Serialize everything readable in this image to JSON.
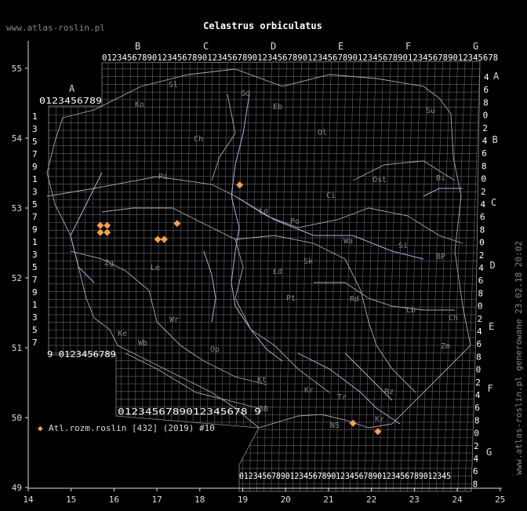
{
  "header": {
    "site": "www.atlas-roslin.pl",
    "title": "Celastrus orbiculatus",
    "generated": "www.atlas-roslin.pl generowane 23.02.18 20:02"
  },
  "axes": {
    "x_ticks": [
      "14",
      "15",
      "16",
      "17",
      "18",
      "19",
      "20",
      "21",
      "22",
      "23",
      "24",
      "25"
    ],
    "y_ticks": [
      "55",
      "54",
      "53",
      "52",
      "51",
      "50",
      "49"
    ]
  },
  "grid_letters": {
    "top_mid": [
      "B",
      "C",
      "D",
      "E",
      "F",
      "G"
    ],
    "top_left": "A",
    "right": [
      "A",
      "B",
      "C",
      "D",
      "E",
      "F",
      "G"
    ]
  },
  "grid_digits": {
    "top_row": "0123456789012345678901234567890123456789012345678901234567890123456789012345678",
    "left_top_row": "0123456789",
    "bottom_left_row": "9 0123456789",
    "bottom_mid_row": "0123456789012345678 9",
    "bottom_right_row": "0123456789012345678901234567890123456789012345",
    "left_col": [
      "1",
      "3",
      "5",
      "7",
      "9",
      "1",
      "3",
      "5",
      "7",
      "9",
      "1",
      "3",
      "5",
      "7",
      "9",
      "1",
      "3",
      "5",
      "7"
    ],
    "right_col": [
      "4",
      "6",
      "8",
      "0",
      "2",
      "4",
      "6",
      "8",
      "0",
      "2",
      "4",
      "6",
      "8",
      "0",
      "2",
      "4",
      "6",
      "8",
      "0",
      "2",
      "4",
      "6",
      "8",
      "0",
      "2",
      "4",
      "6",
      "8",
      "0",
      "2",
      "4",
      "6",
      "8"
    ]
  },
  "regions": [
    "Sl",
    "Gd",
    "Eb",
    "Ko",
    "Su",
    "Ol",
    "Ch",
    "Bi",
    "Pi",
    "Ci",
    "Ło",
    "Po",
    "Ost",
    "Wa",
    "Si",
    "BP",
    "Zg",
    "Le",
    "Sk",
    "Łd",
    "Pt",
    "Rd",
    "Lb",
    "Ch",
    "Wr",
    "Ke",
    "Zm",
    "Wb",
    "Op",
    "Kt",
    "Kr",
    "Tr",
    "Rz",
    "BB",
    "NS",
    "Kr"
  ],
  "legend": {
    "marker": "◆",
    "text": "Atl.rozm.roslin [432] (2019) #10",
    "color": "#ffa040"
  },
  "chart_data": {
    "type": "scatter",
    "title": "Celastrus orbiculatus",
    "x_axis": {
      "label": "",
      "range": [
        14,
        25
      ]
    },
    "y_axis": {
      "label": "",
      "range": [
        49,
        55.5
      ]
    },
    "series": [
      {
        "name": "Atl.rozm.roslin [432] (2019) #10",
        "marker": "diamond",
        "color": "#ffa040",
        "points": [
          {
            "x": 15.68,
            "y": 52.75
          },
          {
            "x": 15.84,
            "y": 52.75
          },
          {
            "x": 15.68,
            "y": 52.65
          },
          {
            "x": 15.84,
            "y": 52.65
          },
          {
            "x": 17.02,
            "y": 52.55
          },
          {
            "x": 17.17,
            "y": 52.55
          },
          {
            "x": 17.47,
            "y": 52.78
          },
          {
            "x": 18.93,
            "y": 53.33
          },
          {
            "x": 21.57,
            "y": 49.92
          },
          {
            "x": 22.15,
            "y": 49.8
          }
        ]
      }
    ]
  }
}
